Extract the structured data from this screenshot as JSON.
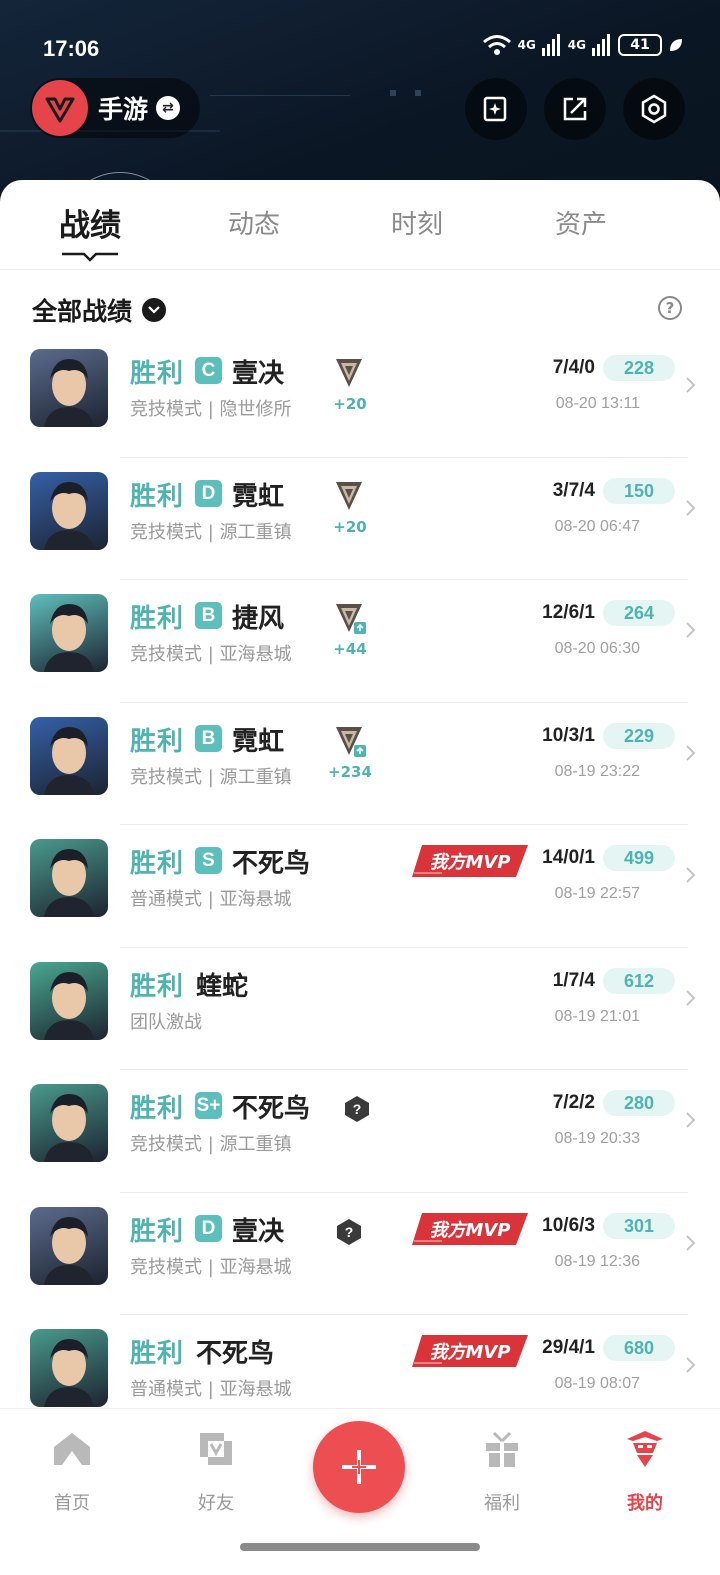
{
  "status": {
    "time": "17:06",
    "net1": "4G",
    "net2": "4G",
    "battery": "41"
  },
  "mode": {
    "label": "手游"
  },
  "tabs": [
    {
      "label": "战绩"
    },
    {
      "label": "动态"
    },
    {
      "label": "时刻"
    },
    {
      "label": "资产"
    }
  ],
  "filter": {
    "label": "全部战绩"
  },
  "matches": [
    {
      "result": "胜利",
      "grade": "C",
      "agent": "壹决",
      "mode": "竞技模式 | 隐世修所",
      "rank_delta": "+20",
      "mvp": false,
      "kda": "7/4/0",
      "score": "228",
      "time": "08-20 13:11",
      "avatar_color": "#5c6b8c",
      "rank_up": false,
      "unranked": false
    },
    {
      "result": "胜利",
      "grade": "D",
      "agent": "霓虹",
      "mode": "竞技模式 | 源工重镇",
      "rank_delta": "+20",
      "mvp": false,
      "kda": "3/7/4",
      "score": "150",
      "time": "08-20 06:47",
      "avatar_color": "#3560a8",
      "rank_up": false,
      "unranked": false
    },
    {
      "result": "胜利",
      "grade": "B",
      "agent": "捷风",
      "mode": "竞技模式 | 亚海悬城",
      "rank_delta": "+44",
      "mvp": false,
      "kda": "12/6/1",
      "score": "264",
      "time": "08-20 06:30",
      "avatar_color": "#5fbfbc",
      "rank_up": true,
      "unranked": false
    },
    {
      "result": "胜利",
      "grade": "B",
      "agent": "霓虹",
      "mode": "竞技模式 | 源工重镇",
      "rank_delta": "+234",
      "mvp": false,
      "kda": "10/3/1",
      "score": "229",
      "time": "08-19 23:22",
      "avatar_color": "#3560a8",
      "rank_up": true,
      "unranked": false
    },
    {
      "result": "胜利",
      "grade": "S",
      "agent": "不死鸟",
      "mode": "普通模式 | 亚海悬城",
      "rank_delta": "",
      "mvp": true,
      "kda": "14/0/1",
      "score": "499",
      "time": "08-19 22:57",
      "avatar_color": "#4a9a8c",
      "rank_up": false,
      "unranked": false
    },
    {
      "result": "胜利",
      "grade": "",
      "agent": "蝰蛇",
      "mode": "团队激战",
      "rank_delta": "",
      "mvp": false,
      "kda": "1/7/4",
      "score": "612",
      "time": "08-19 21:01",
      "avatar_color": "#4aa890",
      "rank_up": false,
      "unranked": false
    },
    {
      "result": "胜利",
      "grade": "S+",
      "agent": "不死鸟",
      "mode": "竞技模式 | 源工重镇",
      "rank_delta": "",
      "mvp": false,
      "kda": "7/2/2",
      "score": "280",
      "time": "08-19 20:33",
      "avatar_color": "#4a9a8c",
      "rank_up": false,
      "unranked": true
    },
    {
      "result": "胜利",
      "grade": "D",
      "agent": "壹决",
      "mode": "竞技模式 | 亚海悬城",
      "rank_delta": "",
      "mvp": true,
      "kda": "10/6/3",
      "score": "301",
      "time": "08-19 12:36",
      "avatar_color": "#5c6b8c",
      "rank_up": false,
      "unranked": true
    },
    {
      "result": "胜利",
      "grade": "",
      "agent": "不死鸟",
      "mode": "普通模式 | 亚海悬城",
      "rank_delta": "",
      "mvp": true,
      "kda": "29/4/1",
      "score": "680",
      "time": "08-19 08:07",
      "avatar_color": "#4a9a8c",
      "rank_up": false,
      "unranked": false
    }
  ],
  "mvp_label": "我方MVP",
  "nav": [
    {
      "label": "首页"
    },
    {
      "label": "好友"
    },
    {
      "label": "福利"
    },
    {
      "label": "我的"
    }
  ],
  "colors": {
    "accent": "#4fb3b0",
    "brand_red": "#e4444a",
    "score_bg": "#e4f5f4"
  }
}
